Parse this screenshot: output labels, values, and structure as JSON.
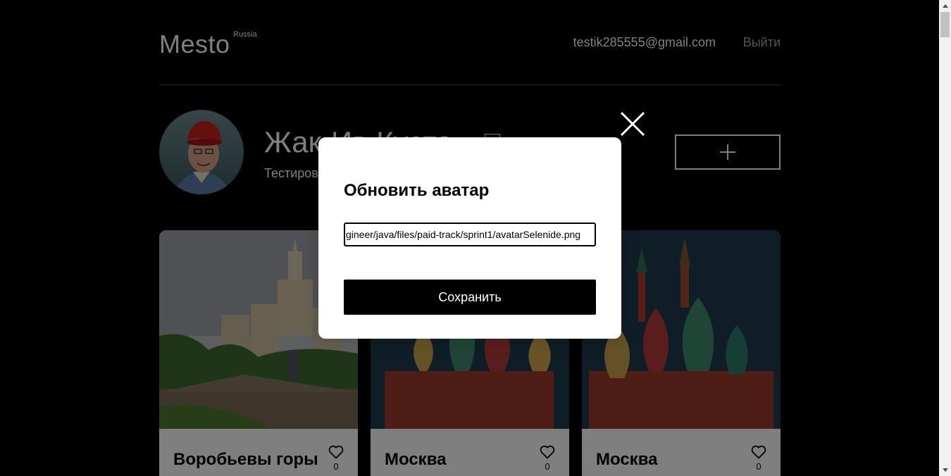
{
  "header": {
    "logo": "Mesto",
    "logo_sup": "Russia",
    "email": "testik285555@gmail.com",
    "logout_label": "Выйти"
  },
  "profile": {
    "name": "Жак-Ив Кусто",
    "about": "Тестировщик"
  },
  "cards": [
    {
      "title": "Воробьевы горы",
      "likes": "0"
    },
    {
      "title": "Москва",
      "likes": "0"
    },
    {
      "title": "Москва",
      "likes": "0"
    }
  ],
  "modal": {
    "title": "Обновить аватар",
    "input_value": "gineer/java/files/paid-track/sprint1/avatarSelenide.png",
    "submit_label": "Сохранить"
  },
  "icons": {
    "close": "close-icon",
    "add": "plus-icon",
    "like": "heart-icon",
    "edit": "edit-icon"
  }
}
